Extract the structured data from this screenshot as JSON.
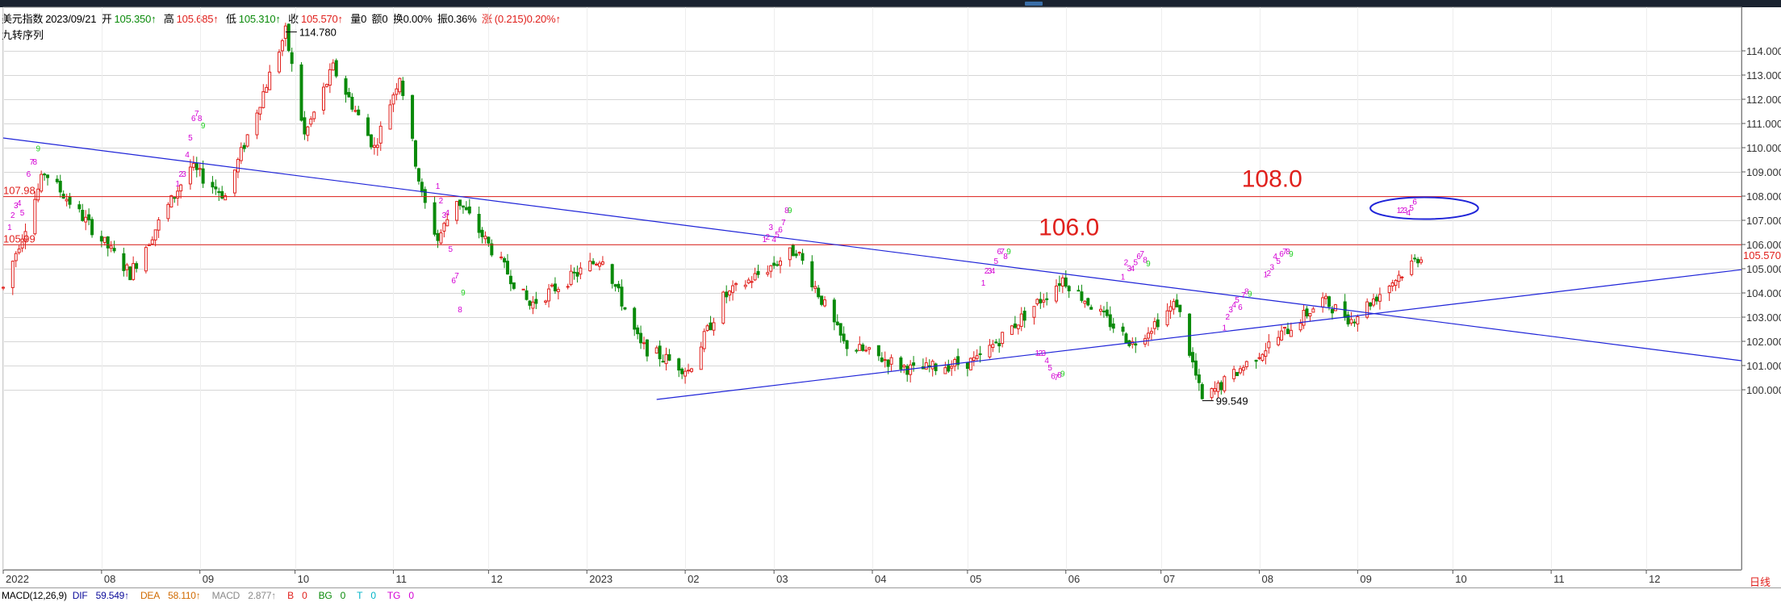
{
  "header": {
    "symbol": "美元指数",
    "date": "2023/09/21",
    "open_label": "开",
    "open": "105.350↑",
    "high_label": "高",
    "high": "105.685↑",
    "low_label": "低",
    "low": "105.310↑",
    "close_label": "收",
    "close": "105.570↑",
    "volume": "量0",
    "amount": "额0",
    "turnover": "换0.00%",
    "amplitude": "振0.36%",
    "change_label": "涨",
    "change": "(0.215)0.20%↑"
  },
  "indicator_name": "九转序列",
  "macd": {
    "params": "MACD(12,26,9)",
    "dif_label": "DIF",
    "dif": "59.549↑",
    "dea_label": "DEA",
    "dea": "58.110↑",
    "macd_label": "MACD",
    "macd": "2.877↑",
    "b_label": "B",
    "b": "0",
    "bg_label": "BG",
    "bg": "0",
    "t_label": "T",
    "t": "0",
    "tg_label": "TG",
    "tg": "0"
  },
  "period_label": "日线",
  "colors": {
    "up": "#e0201c",
    "down": "#0a8a0a",
    "trendline": "#1f24d8",
    "level_line": "#e0201c",
    "td_count": "#d400d4",
    "td_nine": "#20d020",
    "grid": "#d6d6d6"
  },
  "chart_data": {
    "type": "candlestick",
    "y_axis": {
      "min": 99.6,
      "max": 114.8,
      "ticks": [
        "114.000",
        "113.000",
        "112.000",
        "111.000",
        "110.000",
        "109.000",
        "108.000",
        "107.000",
        "106.000",
        "105.000",
        "104.000",
        "103.000",
        "102.000",
        "101.000",
        "100.000"
      ],
      "side": "right"
    },
    "x_axis": {
      "start": "2022-07-01",
      "end": "2023-12-31",
      "ticks": [
        {
          "date": "2022-07-01",
          "label": "2022"
        },
        {
          "date": "2022-08-01",
          "label": "08"
        },
        {
          "date": "2022-09-01",
          "label": "09"
        },
        {
          "date": "2022-10-01",
          "label": "10"
        },
        {
          "date": "2022-11-01",
          "label": "11"
        },
        {
          "date": "2022-12-01",
          "label": "12"
        },
        {
          "date": "2023-01-01",
          "label": "2023"
        },
        {
          "date": "2023-02-01",
          "label": "02"
        },
        {
          "date": "2023-03-01",
          "label": "03"
        },
        {
          "date": "2023-04-01",
          "label": "04"
        },
        {
          "date": "2023-05-01",
          "label": "05"
        },
        {
          "date": "2023-06-01",
          "label": "06"
        },
        {
          "date": "2023-07-01",
          "label": "07"
        },
        {
          "date": "2023-08-01",
          "label": "08"
        },
        {
          "date": "2023-09-01",
          "label": "09"
        },
        {
          "date": "2023-10-01",
          "label": "10"
        },
        {
          "date": "2023-11-01",
          "label": "11"
        },
        {
          "date": "2023-12-01",
          "label": "12"
        }
      ]
    },
    "grid": true,
    "price_path": [
      [
        "2022-07-01",
        104.2
      ],
      [
        "2022-07-14",
        109.0
      ],
      [
        "2022-08-10",
        104.8
      ],
      [
        "2022-08-29",
        109.2
      ],
      [
        "2022-09-09",
        108.0
      ],
      [
        "2022-09-28",
        114.78
      ],
      [
        "2022-10-04",
        110.5
      ],
      [
        "2022-10-13",
        113.3
      ],
      [
        "2022-10-26",
        110.0
      ],
      [
        "2022-11-03",
        113.0
      ],
      [
        "2022-11-10",
        108.0
      ],
      [
        "2022-11-15",
        106.2
      ],
      [
        "2022-11-21",
        107.9
      ],
      [
        "2022-12-14",
        103.5
      ],
      [
        "2023-01-06",
        105.5
      ],
      [
        "2023-01-18",
        101.8
      ],
      [
        "2023-02-02",
        100.8
      ],
      [
        "2023-02-13",
        103.8
      ],
      [
        "2023-03-08",
        105.8
      ],
      [
        "2023-03-23",
        101.9
      ],
      [
        "2023-04-14",
        100.8
      ],
      [
        "2023-05-04",
        101.2
      ],
      [
        "2023-05-31",
        104.6
      ],
      [
        "2023-06-22",
        101.9
      ],
      [
        "2023-07-06",
        103.6
      ],
      [
        "2023-07-14",
        99.549
      ],
      [
        "2023-08-21",
        103.7
      ],
      [
        "2023-08-30",
        102.9
      ],
      [
        "2023-09-21",
        105.57
      ]
    ],
    "value_labels": [
      {
        "date": "2022-09-28",
        "value": 114.78,
        "text": "114.780",
        "position": "right"
      },
      {
        "date": "2023-07-14",
        "value": 99.549,
        "text": "99.549",
        "position": "right"
      }
    ],
    "last_price": {
      "value": 105.57,
      "text": "105.570"
    },
    "horizontal_levels": [
      {
        "value": 107.98,
        "left_label": "107.98",
        "annotation": "108.0",
        "annotation_date": "2023-08-05"
      },
      {
        "value": 105.99,
        "left_label": "105.99",
        "annotation": "106.0",
        "annotation_date": "2023-06-02"
      }
    ],
    "trendlines": [
      {
        "from": [
          "2022-07-01",
          110.4
        ],
        "to": [
          "2023-12-31",
          101.2
        ]
      },
      {
        "from": [
          "2023-01-23",
          99.6
        ],
        "to": [
          "2023-12-31",
          104.96
        ]
      }
    ],
    "ellipse": {
      "center": [
        "2023-09-22",
        107.5
      ],
      "rx_days": 17,
      "ry": 0.45
    },
    "td_counts": [
      {
        "date": "2022-07-03",
        "value": 106.6,
        "text": "1"
      },
      {
        "date": "2022-07-04",
        "value": 107.1,
        "text": "2"
      },
      {
        "date": "2022-07-05",
        "value": 107.5,
        "text": "3"
      },
      {
        "date": "2022-07-06",
        "value": 107.6,
        "text": "4"
      },
      {
        "date": "2022-07-07",
        "value": 107.2,
        "text": "5"
      },
      {
        "date": "2022-07-09",
        "value": 108.8,
        "text": "6"
      },
      {
        "date": "2022-07-10",
        "value": 109.3,
        "text": "7"
      },
      {
        "date": "2022-07-11",
        "value": 109.3,
        "text": "8"
      },
      {
        "date": "2022-07-12",
        "value": 109.85,
        "text": "9",
        "nine": true
      },
      {
        "date": "2022-08-25",
        "value": 108.4,
        "text": "1"
      },
      {
        "date": "2022-08-26",
        "value": 108.8,
        "text": "2"
      },
      {
        "date": "2022-08-27",
        "value": 108.8,
        "text": "3"
      },
      {
        "date": "2022-08-28",
        "value": 109.6,
        "text": "4"
      },
      {
        "date": "2022-08-29",
        "value": 110.3,
        "text": "5"
      },
      {
        "date": "2022-08-30",
        "value": 111.1,
        "text": "6"
      },
      {
        "date": "2022-08-31",
        "value": 111.3,
        "text": "7"
      },
      {
        "date": "2022-09-01",
        "value": 111.1,
        "text": "8"
      },
      {
        "date": "2022-09-02",
        "value": 110.8,
        "text": "9",
        "nine": true
      },
      {
        "date": "2022-11-15",
        "value": 108.3,
        "text": "1"
      },
      {
        "date": "2022-11-16",
        "value": 107.7,
        "text": "2"
      },
      {
        "date": "2022-11-17",
        "value": 107.1,
        "text": "3"
      },
      {
        "date": "2022-11-18",
        "value": 107.2,
        "text": "4"
      },
      {
        "date": "2022-11-19",
        "value": 105.7,
        "text": "5"
      },
      {
        "date": "2022-11-20",
        "value": 104.4,
        "text": "6"
      },
      {
        "date": "2022-11-21",
        "value": 104.6,
        "text": "7"
      },
      {
        "date": "2022-11-22",
        "value": 103.2,
        "text": "8"
      },
      {
        "date": "2022-11-23",
        "value": 103.9,
        "text": "9",
        "nine": true
      },
      {
        "date": "2023-02-26",
        "value": 106.1,
        "text": "1"
      },
      {
        "date": "2023-02-27",
        "value": 106.2,
        "text": "2"
      },
      {
        "date": "2023-02-28",
        "value": 106.6,
        "text": "3"
      },
      {
        "date": "2023-03-01",
        "value": 106.1,
        "text": "4"
      },
      {
        "date": "2023-03-02",
        "value": 106.3,
        "text": "5"
      },
      {
        "date": "2023-03-03",
        "value": 106.5,
        "text": "6"
      },
      {
        "date": "2023-03-04",
        "value": 106.8,
        "text": "7"
      },
      {
        "date": "2023-03-05",
        "value": 107.3,
        "text": "8"
      },
      {
        "date": "2023-03-06",
        "value": 107.3,
        "text": "9",
        "nine": true
      },
      {
        "date": "2023-05-06",
        "value": 104.3,
        "text": "1"
      },
      {
        "date": "2023-05-07",
        "value": 104.8,
        "text": "2"
      },
      {
        "date": "2023-05-08",
        "value": 104.8,
        "text": "3"
      },
      {
        "date": "2023-05-09",
        "value": 104.8,
        "text": "4"
      },
      {
        "date": "2023-05-10",
        "value": 105.2,
        "text": "5"
      },
      {
        "date": "2023-05-11",
        "value": 105.6,
        "text": "6"
      },
      {
        "date": "2023-05-12",
        "value": 105.6,
        "text": "7"
      },
      {
        "date": "2023-05-13",
        "value": 105.4,
        "text": "8"
      },
      {
        "date": "2023-05-14",
        "value": 105.6,
        "text": "9",
        "nine": true
      },
      {
        "date": "2023-05-23",
        "value": 101.4,
        "text": "1"
      },
      {
        "date": "2023-05-24",
        "value": 101.4,
        "text": "2"
      },
      {
        "date": "2023-05-25",
        "value": 101.4,
        "text": "3"
      },
      {
        "date": "2023-05-26",
        "value": 101.1,
        "text": "4"
      },
      {
        "date": "2023-05-27",
        "value": 100.8,
        "text": "5"
      },
      {
        "date": "2023-05-28",
        "value": 100.45,
        "text": "6"
      },
      {
        "date": "2023-05-29",
        "value": 100.4,
        "text": "7"
      },
      {
        "date": "2023-05-30",
        "value": 100.5,
        "text": "8"
      },
      {
        "date": "2023-05-31",
        "value": 100.55,
        "text": "9",
        "nine": true
      },
      {
        "date": "2023-06-19",
        "value": 104.55,
        "text": "1"
      },
      {
        "date": "2023-06-20",
        "value": 105.15,
        "text": "2"
      },
      {
        "date": "2023-06-21",
        "value": 104.9,
        "text": "3"
      },
      {
        "date": "2023-06-22",
        "value": 104.9,
        "text": "4"
      },
      {
        "date": "2023-06-23",
        "value": 105.15,
        "text": "5"
      },
      {
        "date": "2023-06-24",
        "value": 105.4,
        "text": "6"
      },
      {
        "date": "2023-06-25",
        "value": 105.5,
        "text": "7"
      },
      {
        "date": "2023-06-26",
        "value": 105.25,
        "text": "8"
      },
      {
        "date": "2023-06-27",
        "value": 105.1,
        "text": "9",
        "nine": true
      },
      {
        "date": "2023-07-21",
        "value": 102.45,
        "text": "1"
      },
      {
        "date": "2023-07-22",
        "value": 102.9,
        "text": "2"
      },
      {
        "date": "2023-07-23",
        "value": 103.2,
        "text": "3"
      },
      {
        "date": "2023-07-24",
        "value": 103.4,
        "text": "4"
      },
      {
        "date": "2023-07-25",
        "value": 103.6,
        "text": "5"
      },
      {
        "date": "2023-07-26",
        "value": 103.3,
        "text": "6"
      },
      {
        "date": "2023-07-27",
        "value": 103.8,
        "text": "7"
      },
      {
        "date": "2023-07-28",
        "value": 103.95,
        "text": "8"
      },
      {
        "date": "2023-07-29",
        "value": 103.85,
        "text": "9",
        "nine": true
      },
      {
        "date": "2023-08-03",
        "value": 104.65,
        "text": "1"
      },
      {
        "date": "2023-08-04",
        "value": 104.7,
        "text": "2"
      },
      {
        "date": "2023-08-05",
        "value": 104.95,
        "text": "3"
      },
      {
        "date": "2023-08-06",
        "value": 105.4,
        "text": "4"
      },
      {
        "date": "2023-08-07",
        "value": 105.2,
        "text": "5"
      },
      {
        "date": "2023-08-08",
        "value": 105.5,
        "text": "6"
      },
      {
        "date": "2023-08-09",
        "value": 105.6,
        "text": "7"
      },
      {
        "date": "2023-08-10",
        "value": 105.6,
        "text": "8"
      },
      {
        "date": "2023-08-11",
        "value": 105.5,
        "text": "9",
        "nine": true
      },
      {
        "date": "2023-09-14",
        "value": 107.3,
        "text": "1"
      },
      {
        "date": "2023-09-15",
        "value": 107.3,
        "text": "2"
      },
      {
        "date": "2023-09-16",
        "value": 107.3,
        "text": "3"
      },
      {
        "date": "2023-09-17",
        "value": 107.2,
        "text": "4"
      },
      {
        "date": "2023-09-18",
        "value": 107.4,
        "text": "5"
      },
      {
        "date": "2023-09-19",
        "value": 107.65,
        "text": "6"
      }
    ]
  }
}
